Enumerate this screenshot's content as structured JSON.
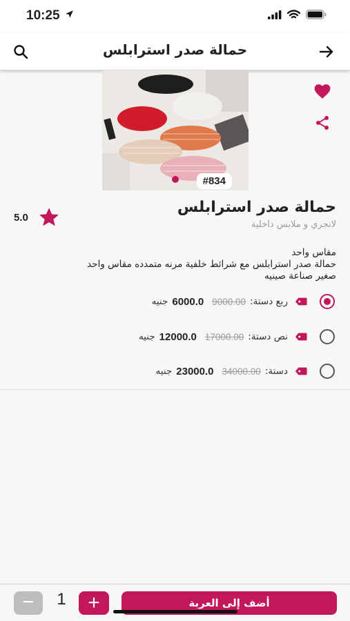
{
  "status_bar": {
    "time": "10:25"
  },
  "app_bar": {
    "title": "حمالة صدر استرابلس"
  },
  "product": {
    "code_badge": "#834",
    "name": "حمالة صدر استرابلس",
    "category": "لانجري و ملابس داخلية",
    "rating": "5.0",
    "description_lines": [
      "مقاس واحد",
      "حمالة صدر استرابلس مع شرائط خلفية مرنه متمدده مقاس واحد",
      "صغير صناعة صينيه"
    ]
  },
  "options": [
    {
      "label": "ربع دستة:",
      "old_price": "9000.00",
      "price": "6000.0",
      "currency": "جنيه",
      "selected": true
    },
    {
      "label": "نص دستة:",
      "old_price": "17000.00",
      "price": "12000.0",
      "currency": "جنيه",
      "selected": false
    },
    {
      "label": "دستة:",
      "old_price": "34000.00",
      "price": "23000.0",
      "currency": "جنيه",
      "selected": false
    }
  ],
  "bottom_bar": {
    "minus_label": "−",
    "quantity": "1",
    "plus_label": "+",
    "add_to_cart_label": "أضف إلى العربة"
  },
  "colors": {
    "accent": "#c2185b",
    "muted": "#9a9a9a",
    "background": "#f7f7f7"
  },
  "icons": [
    "search-icon",
    "arrow-forward-icon",
    "heart-icon",
    "share-icon",
    "star-icon",
    "tag-icon",
    "signal-icon",
    "wifi-icon",
    "battery-icon",
    "location-arrow-icon"
  ]
}
